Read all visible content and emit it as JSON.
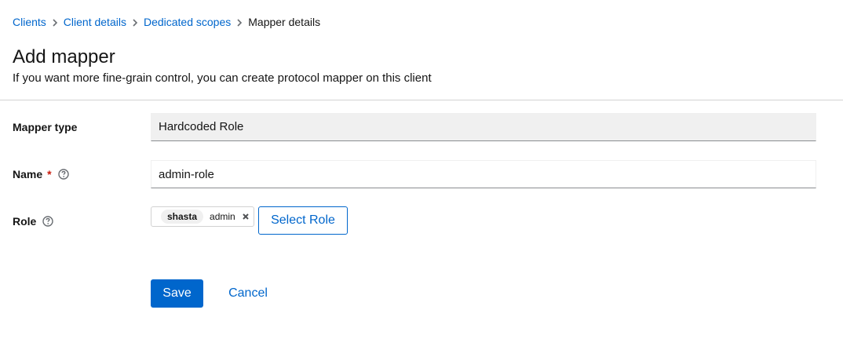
{
  "breadcrumb": {
    "items": [
      {
        "label": "Clients"
      },
      {
        "label": "Client details"
      },
      {
        "label": "Dedicated scopes"
      }
    ],
    "current": "Mapper details"
  },
  "header": {
    "title": "Add mapper",
    "subtitle": "If you want more fine-grain control, you can create protocol mapper on this client"
  },
  "form": {
    "mapper_type": {
      "label": "Mapper type",
      "value": "Hardcoded Role"
    },
    "name": {
      "label": "Name",
      "required_mark": "*",
      "value": "admin-role"
    },
    "role": {
      "label": "Role",
      "chip_client": "shasta",
      "chip_role": "admin",
      "select_button": "Select Role"
    }
  },
  "actions": {
    "save": "Save",
    "cancel": "Cancel"
  },
  "icons": {
    "breadcrumb_separator": "chevron-right-icon",
    "help": "question-circle-icon",
    "remove_chip": "times-icon"
  },
  "colors": {
    "link": "#0066cc",
    "primary_button": "#0066cc",
    "required": "#c9190b",
    "readonly_field": "#f0f0f0",
    "divider": "#d2d2d2"
  }
}
